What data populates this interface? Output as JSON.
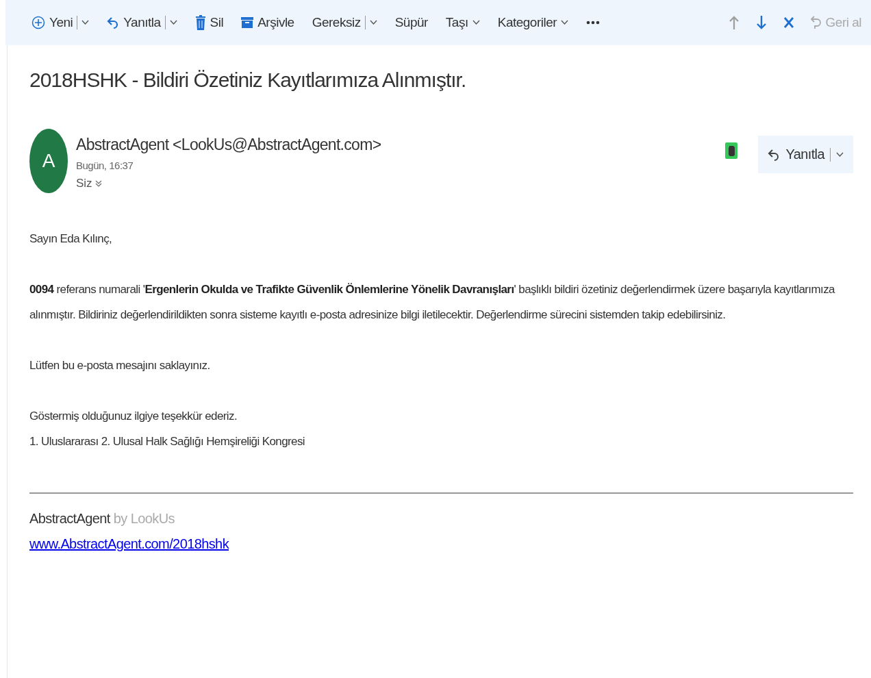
{
  "toolbar": {
    "actions": [
      {
        "label": "Yeni",
        "kind": "split"
      },
      {
        "label": "Yanıtla",
        "kind": "split"
      },
      {
        "label": "Sil",
        "kind": "plain"
      },
      {
        "label": "Arşivle",
        "kind": "plain"
      },
      {
        "label": "Gereksiz",
        "kind": "split"
      },
      {
        "label": "Süpür",
        "kind": "plain"
      },
      {
        "label": "Taşı",
        "kind": "menu"
      },
      {
        "label": "Kategoriler",
        "kind": "menu"
      }
    ],
    "nav": [
      {
        "disabled": true
      },
      {
        "disabled": false
      },
      {
        "disabled": false
      }
    ],
    "undo": {
      "label": "Geri al",
      "disabled": true
    }
  },
  "message": {
    "subject": "2018HSHK - Bildiri Özetiniz Kayıtlarımıza Alınmıştır.",
    "sender": {
      "initial": "A",
      "name": "AbstractAgent <LookUs@AbstractAgent.com>",
      "time": "Bugün, 16:37",
      "recipients": "Siz"
    },
    "reply_button": "Yanıtla",
    "body": [
      [
        "Sayın Eda Kılınç,"
      ],
      [
        "**0094** referans numarali '**Ergenlerin Okulda ve Trafikte Güvenlik Önlemlerine Yönelik Davranışları**' başlıklı bildiri özetiniz değerlendirmek üzere başarıyla kayıtlarımıza alınmıştır. Bildiriniz değerlendirildikten sonra sisteme kayıtlı e-posta adresinize bilgi iletilecektir. Değerlendirme sürecini sistemden takip edebilirsiniz."
      ],
      [
        "Lütfen bu e-posta mesajını saklayınız."
      ],
      [
        "Göstermiş olduğunuz ilgiye teşekkür ederiz.",
        "1. Uluslararası 2. Ulusal Halk Sağlığı Hemşireliği Kongresi"
      ]
    ],
    "signature": {
      "name": "AbstractAgent",
      "suffix": "by LookUs",
      "link": "www.AbstractAgent.com/2018hshk"
    }
  }
}
